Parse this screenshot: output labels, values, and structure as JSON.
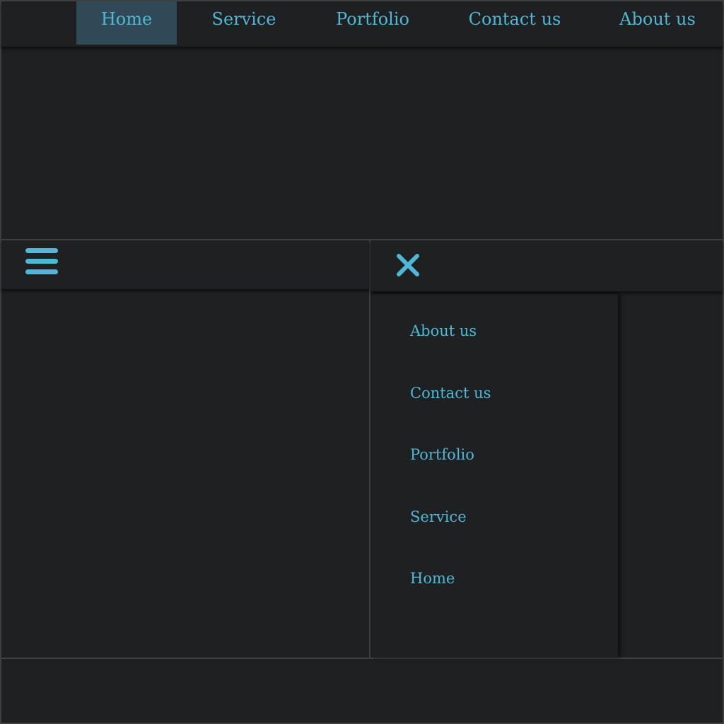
{
  "colors": {
    "accent": "#4fb8d6",
    "background": "#1f2021",
    "active_bg": "#2f4a56"
  },
  "desktop_nav": {
    "items": [
      {
        "label": "Home",
        "active": true
      },
      {
        "label": "Service",
        "active": false
      },
      {
        "label": "Portfolio",
        "active": false
      },
      {
        "label": "Contact us",
        "active": false
      },
      {
        "label": "About us",
        "active": false
      }
    ]
  },
  "mobile_closed": {
    "icon": "hamburger-menu-icon"
  },
  "mobile_open": {
    "icon": "close-x-icon",
    "drawer_items": [
      {
        "label": "About us"
      },
      {
        "label": "Contact us"
      },
      {
        "label": "Portfolio"
      },
      {
        "label": "Service"
      },
      {
        "label": "Home"
      }
    ]
  }
}
